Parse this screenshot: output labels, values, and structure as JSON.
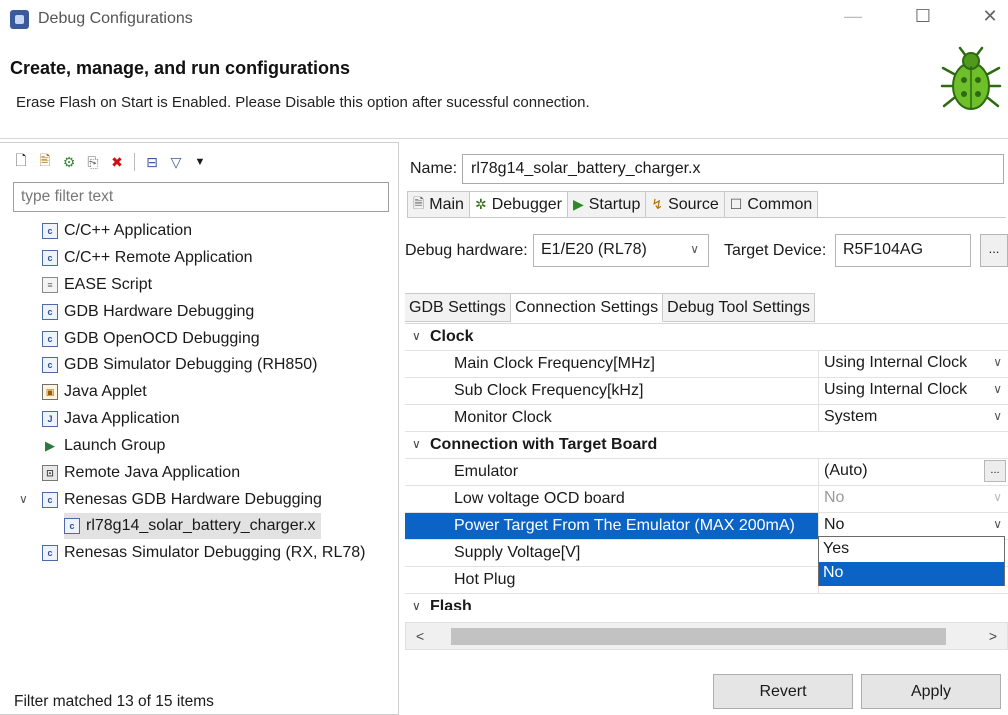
{
  "window": {
    "title": "Debug Configurations",
    "minimize_icon": "minimize-icon",
    "maximize_glyph": "☐",
    "close_glyph": "✕"
  },
  "header": {
    "title": "Create, manage, and run configurations",
    "message": "Erase Flash on Start is Enabled. Please Disable this option after sucessful connection."
  },
  "left": {
    "filter_placeholder": "type filter text",
    "tree": [
      {
        "label": "C/C++ Application",
        "icon": "c-app-icon"
      },
      {
        "label": "C/C++ Remote Application",
        "icon": "c-app-icon"
      },
      {
        "label": "EASE Script",
        "icon": "script-icon"
      },
      {
        "label": "GDB Hardware Debugging",
        "icon": "c-app-icon"
      },
      {
        "label": "GDB OpenOCD Debugging",
        "icon": "c-app-icon"
      },
      {
        "label": "GDB Simulator Debugging (RH850)",
        "icon": "c-app-icon"
      },
      {
        "label": "Java Applet",
        "icon": "java-applet-icon"
      },
      {
        "label": "Java Application",
        "icon": "java-app-icon"
      },
      {
        "label": "Launch Group",
        "icon": "launch-group-icon"
      },
      {
        "label": "Remote Java Application",
        "icon": "remote-java-icon"
      },
      {
        "label": "Renesas GDB Hardware Debugging",
        "icon": "c-app-icon",
        "expanded": true
      },
      {
        "label": "rl78g14_solar_battery_charger.x",
        "icon": "c-config-icon",
        "selected": true
      },
      {
        "label": "Renesas Simulator Debugging (RX, RL78)",
        "icon": "c-app-icon"
      }
    ],
    "status": "Filter matched 13 of 15 items"
  },
  "right": {
    "name_label": "Name:",
    "name_value": "rl78g14_solar_battery_charger.x",
    "tabs": [
      {
        "label": "Main",
        "icon": "main-tab-icon"
      },
      {
        "label": "Debugger",
        "icon": "debugger-tab-icon",
        "active": true
      },
      {
        "label": "Startup",
        "icon": "startup-tab-icon"
      },
      {
        "label": "Source",
        "icon": "source-tab-icon"
      },
      {
        "label": "Common",
        "icon": "common-tab-icon"
      }
    ],
    "debug_hw_label": "Debug hardware:",
    "debug_hw_value": "E1/E20 (RL78)",
    "target_device_label": "Target Device:",
    "target_device_value": "R5F104AG",
    "target_device_btn": "...",
    "subtabs": [
      {
        "label": "GDB Settings"
      },
      {
        "label": "Connection Settings",
        "active": true
      },
      {
        "label": "Debug Tool Settings"
      }
    ],
    "grid": [
      {
        "type": "cat",
        "key": "Clock"
      },
      {
        "type": "row",
        "key": "Main Clock Frequency[MHz]",
        "value": "Using Internal Clock",
        "control": "dropdown"
      },
      {
        "type": "row",
        "key": "Sub Clock Frequency[kHz]",
        "value": "Using Internal Clock",
        "control": "dropdown"
      },
      {
        "type": "row",
        "key": "Monitor Clock",
        "value": "System",
        "control": "dropdown"
      },
      {
        "type": "cat",
        "key": "Connection with Target Board"
      },
      {
        "type": "row",
        "key": "Emulator",
        "value": "(Auto)",
        "control": "ellipsis"
      },
      {
        "type": "row",
        "key": "Low voltage OCD board",
        "value": "No",
        "control": "dropdown",
        "disabled": true
      },
      {
        "type": "row",
        "key": "Power Target From The Emulator (MAX 200mA)",
        "value": "No",
        "control": "dropdown",
        "selected": true
      },
      {
        "type": "row",
        "key": "Supply Voltage[V]",
        "value": ""
      },
      {
        "type": "row",
        "key": "Hot Plug",
        "value": ""
      },
      {
        "type": "cat",
        "key": "Flash"
      }
    ],
    "dropdown_options": [
      "Yes",
      "No"
    ],
    "dropdown_selected": "No",
    "scroll_left": "<",
    "scroll_right": ">"
  },
  "buttons": {
    "revert": "Revert",
    "apply": "Apply"
  }
}
